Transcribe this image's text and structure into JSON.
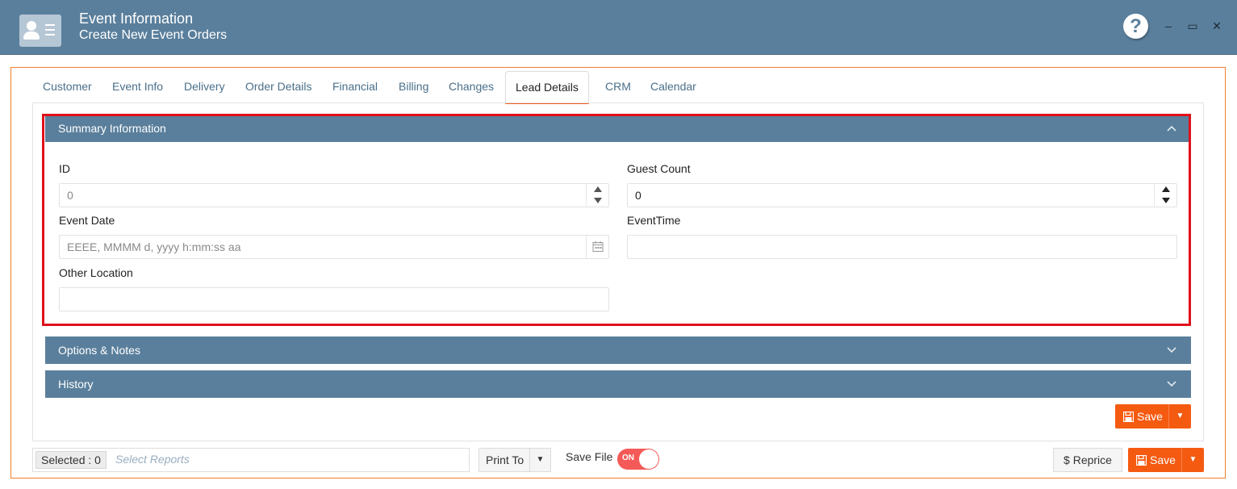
{
  "window": {
    "title": "Event Information",
    "subtitle": "Create New Event Orders",
    "help_glyph": "?",
    "minimize_glyph": "–",
    "maximize_glyph": "▭",
    "close_glyph": "✕"
  },
  "tabs": [
    {
      "label": "Customer"
    },
    {
      "label": "Event Info"
    },
    {
      "label": "Delivery"
    },
    {
      "label": "Order Details"
    },
    {
      "label": "Financial"
    },
    {
      "label": "Billing"
    },
    {
      "label": "Changes"
    },
    {
      "label": "Lead Details",
      "active": true
    },
    {
      "label": "CRM"
    },
    {
      "label": "Calendar"
    }
  ],
  "sections": {
    "summary": {
      "title": "Summary Information",
      "expanded": true,
      "fields": {
        "id_label": "ID",
        "id_value": "0",
        "guest_count_label": "Guest Count",
        "guest_count_value": "0",
        "event_date_label": "Event Date",
        "event_date_placeholder": "EEEE, MMMM d, yyyy h:mm:ss aa",
        "event_time_label": "EventTime",
        "event_time_value": "",
        "other_location_label": "Other Location",
        "other_location_value": ""
      }
    },
    "options_notes": {
      "title": "Options & Notes",
      "expanded": false
    },
    "history": {
      "title": "History",
      "expanded": false
    }
  },
  "panel_actions": {
    "save_label": "Save"
  },
  "footer": {
    "selected_label": "Selected : 0",
    "reports_placeholder": "Select Reports",
    "print_to_label": "Print To",
    "save_file_label": "Save File",
    "save_file_toggle": "ON",
    "reprice_label": "$  Reprice",
    "save_label": "Save"
  },
  "colors": {
    "header_bg": "#5a7f9c",
    "accent_orange": "#f55a11",
    "highlight_red": "#e0101a",
    "toggle_on": "#f45a57"
  },
  "icons": {
    "app": "contact-card-icon",
    "help": "help-icon",
    "calendar": "calendar-icon",
    "save": "floppy-disk-icon",
    "expand": "chevron-icon",
    "dropdown": "caret-down-icon"
  }
}
